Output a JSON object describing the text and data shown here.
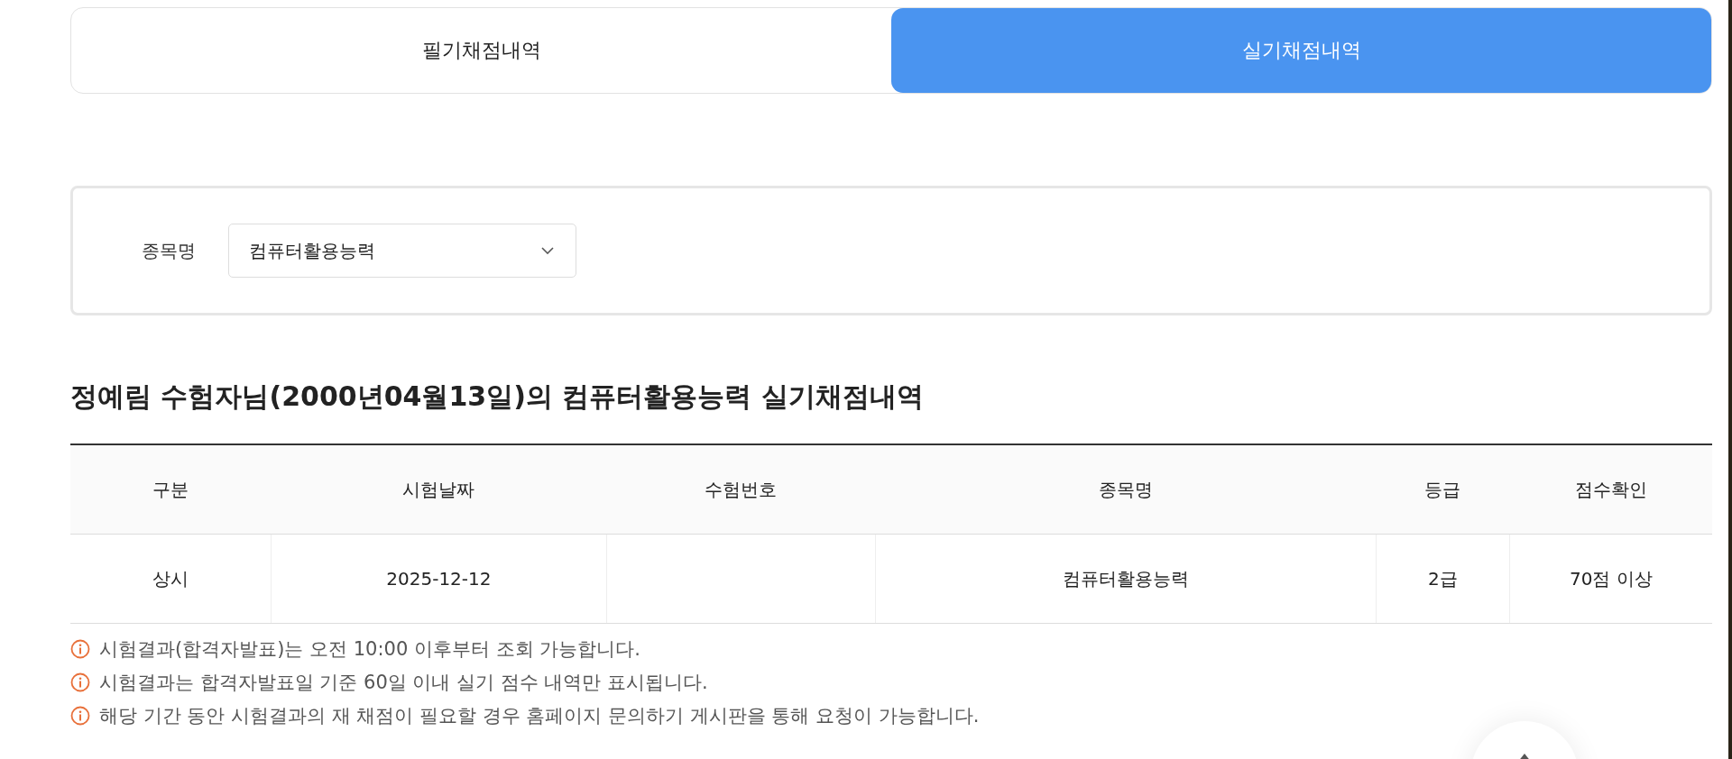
{
  "tabs": [
    {
      "label": "필기채점내역",
      "selected": false
    },
    {
      "label": "실기채점내역",
      "selected": true
    }
  ],
  "filter": {
    "label": "종목명",
    "value": "컴퓨터활용능력"
  },
  "heading": "정예림 수험자님(2000년04월13일)의 컴퓨터활용능력 실기채점내역",
  "table": {
    "columns": [
      "구분",
      "시험날짜",
      "수험번호",
      "종목명",
      "등급",
      "점수확인"
    ],
    "rows": [
      [
        "상시",
        "2025-12-12",
        "",
        "컴퓨터활용능력",
        "2급",
        "70점 이상"
      ]
    ]
  },
  "notices": [
    "시험결과(합격자발표)는 오전 10:00 이후부터 조회 가능합니다.",
    "시험결과는 합격자발표일 기준 60일 이내 실기 점수 내역만 표시됩니다.",
    "해당 기간 동안 시험결과의 재 채점이 필요할 경우 홈페이지 문의하기 게시판을 통해 요청이 가능합니다."
  ]
}
